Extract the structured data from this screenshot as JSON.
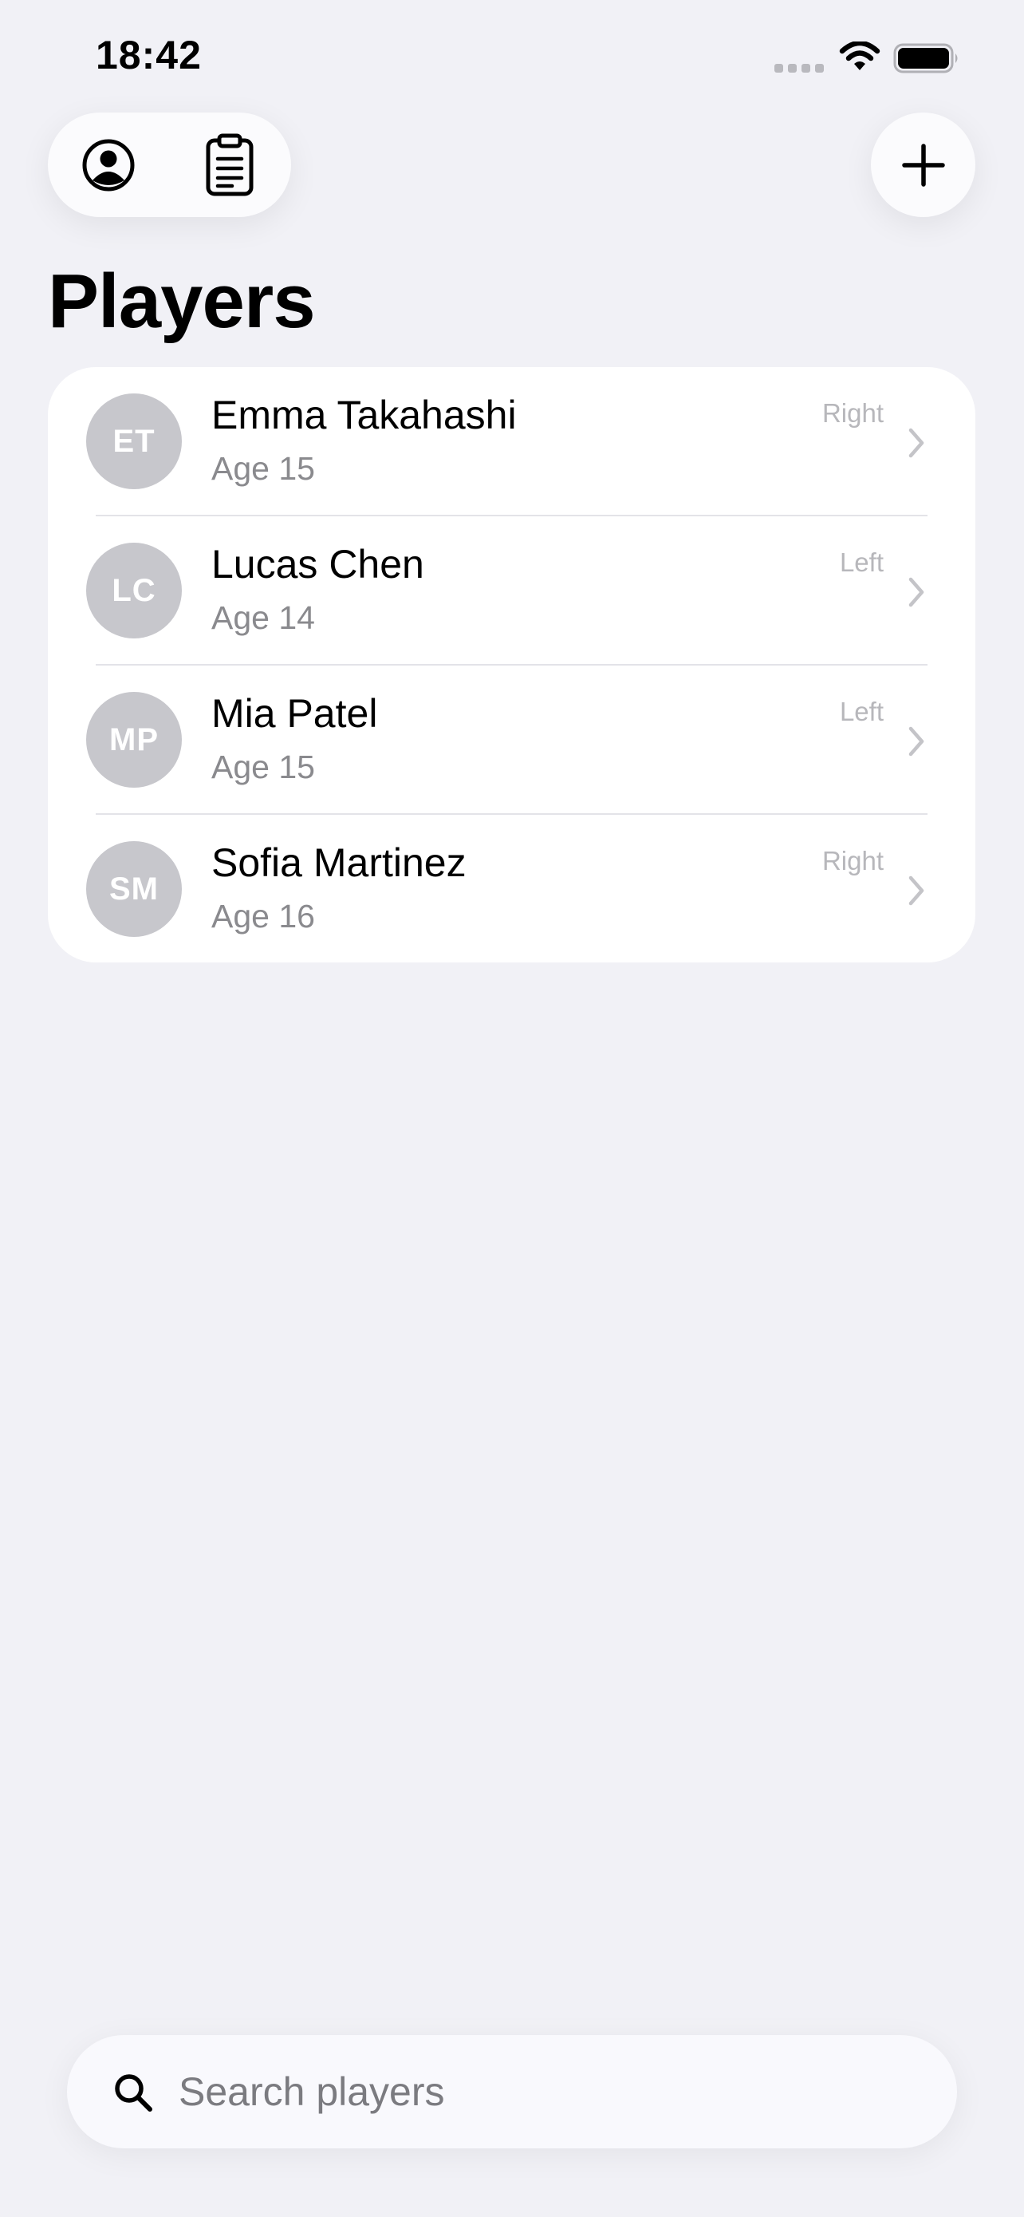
{
  "status_bar": {
    "time": "18:42",
    "icons": [
      "cellular-signal-icon",
      "wifi-icon",
      "battery-icon"
    ]
  },
  "toolbar": {
    "left_buttons": [
      {
        "icon": "person-circle-icon"
      },
      {
        "icon": "clipboard-icon"
      }
    ],
    "right_button": {
      "icon": "plus-icon"
    }
  },
  "page": {
    "title": "Players"
  },
  "players": [
    {
      "initials": "ET",
      "name": "Emma Takahashi",
      "age": "Age 15",
      "hand": "Right"
    },
    {
      "initials": "LC",
      "name": "Lucas Chen",
      "age": "Age 14",
      "hand": "Left"
    },
    {
      "initials": "MP",
      "name": "Mia Patel",
      "age": "Age 15",
      "hand": "Left"
    },
    {
      "initials": "SM",
      "name": "Sofia Martinez",
      "age": "Age 16",
      "hand": "Right"
    }
  ],
  "search": {
    "placeholder": "Search players",
    "value": ""
  },
  "colors": {
    "background": "#f1f1f6",
    "card": "#ffffff",
    "avatar": "#c7c7cc",
    "secondary_text": "#8a8a8e",
    "tertiary_text": "#b7b7bb"
  }
}
